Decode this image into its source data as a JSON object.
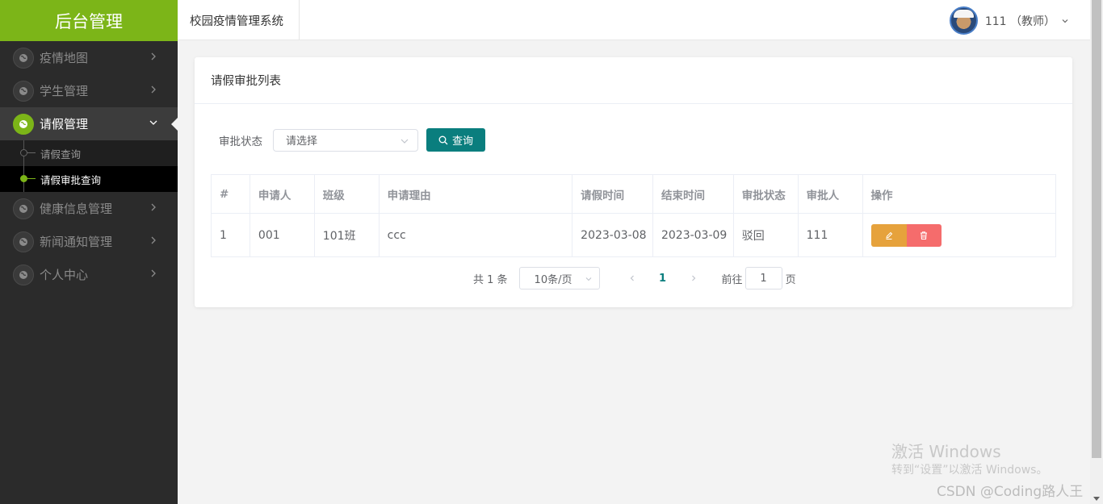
{
  "sidebar": {
    "logo": "后台管理",
    "items": [
      {
        "label": "疫情地图"
      },
      {
        "label": "学生管理"
      },
      {
        "label": "请假管理"
      },
      {
        "label": "健康信息管理"
      },
      {
        "label": "新闻通知管理"
      },
      {
        "label": "个人中心"
      }
    ],
    "subitems": [
      {
        "label": "请假查询"
      },
      {
        "label": "请假审批查询"
      }
    ]
  },
  "header": {
    "system_name": "校园疫情管理系统",
    "user_label": "111 （教师）"
  },
  "card": {
    "title": "请假审批列表",
    "filter": {
      "label": "审批状态",
      "placeholder": "请选择",
      "search_label": "查询"
    },
    "table": {
      "columns": [
        "#",
        "申请人",
        "班级",
        "申请理由",
        "请假时间",
        "结束时间",
        "审批状态",
        "审批人",
        "操作"
      ],
      "rows": [
        [
          "1",
          "001",
          "101班",
          "ccc",
          "2023-03-08",
          "2023-03-09",
          "驳回",
          "111"
        ]
      ]
    },
    "pagination": {
      "total_text": "共 1 条",
      "page_size": "10条/页",
      "current_page": "1",
      "goto_prefix": "前往",
      "goto_value": "1",
      "goto_suffix": "页"
    }
  },
  "watermark": {
    "activate_title": "激活 Windows",
    "activate_sub": "转到“设置”以激活 Windows。",
    "credit": "CSDN @Coding路人王"
  },
  "colors": {
    "brand_green": "#7cb518",
    "primary_teal": "#0a7e7e",
    "edit_orange": "#e6a23c",
    "delete_red": "#f56c6c"
  }
}
